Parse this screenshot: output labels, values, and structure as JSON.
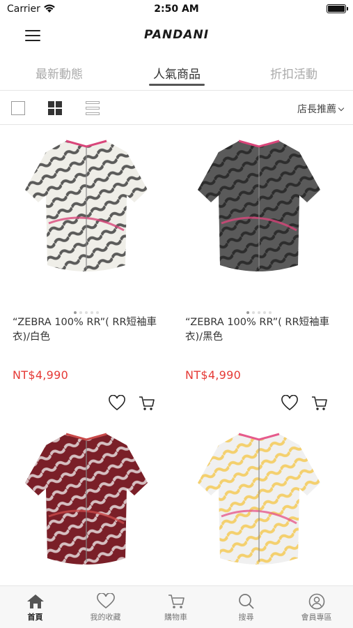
{
  "status": {
    "carrier": "Carrier",
    "time": "2:50 AM"
  },
  "header": {
    "logo": "PANDANI"
  },
  "tabs": [
    {
      "label": "最新動態",
      "active": false
    },
    {
      "label": "人氣商品",
      "active": true
    },
    {
      "label": "折扣活動",
      "active": false
    }
  ],
  "toolbar": {
    "sort_label": "店長推薦"
  },
  "products": [
    {
      "name": "“ZEBRA 100% RR”( RR短袖車衣)/白色",
      "price": "NT$4,990",
      "jersey_color": "#efeee8",
      "stripe_color": "#2a2a2a",
      "accent": "#d9467a"
    },
    {
      "name": "“ZEBRA 100% RR”( RR短袖車衣)/黑色",
      "price": "NT$4,990",
      "jersey_color": "#5a5a5a",
      "stripe_color": "#1e1e1e",
      "accent": "#d9467a"
    },
    {
      "name": "",
      "price": "",
      "jersey_color": "#7a1f28",
      "stripe_color": "#f3f3f3",
      "accent": "#c94a4a"
    },
    {
      "name": "",
      "price": "",
      "jersey_color": "#f0f0f0",
      "stripe_color": "#f5c542",
      "accent": "#e65a8c"
    }
  ],
  "tabbar": [
    {
      "label": "首頁",
      "icon": "home-icon",
      "active": true
    },
    {
      "label": "我的收藏",
      "icon": "heart-icon",
      "active": false
    },
    {
      "label": "購物車",
      "icon": "cart-icon",
      "active": false
    },
    {
      "label": "搜尋",
      "icon": "search-icon",
      "active": false
    },
    {
      "label": "會員專區",
      "icon": "user-icon",
      "active": false
    }
  ]
}
